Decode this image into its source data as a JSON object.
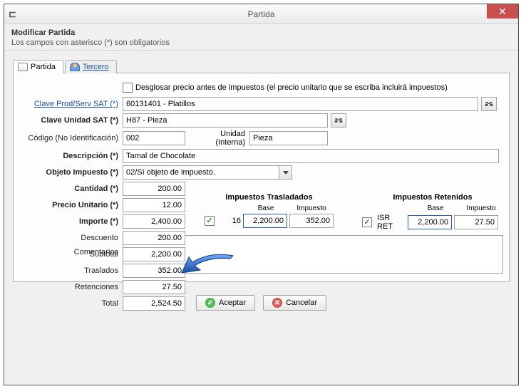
{
  "window": {
    "title": "Partida"
  },
  "header": {
    "title": "Modificar Partida",
    "subtitle": "Los campos con asterisco (*) son obligatorios"
  },
  "tabs": {
    "t0": "Partida",
    "t1": "Tercero"
  },
  "labels": {
    "desglosar": "Desglosar precio antes de impuestos (el precio unitario que se escriba incluirá impuestos)",
    "claveProdServ": "Clave Prod/Serv SAT (*)",
    "claveUnidad": "Clave Unidad SAT (*)",
    "codigo": "Código (No Identificación)",
    "unidadInterna": "Unidad (Interna)",
    "descripcion": "Descripción (*)",
    "objetoImpuesto": "Objeto Impuesto (*)",
    "cantidad": "Cantidad (*)",
    "precioUnitario": "Precio Unitario (*)",
    "importe": "Importe (*)",
    "descuento": "Descuento",
    "subtotal": "Subtotal",
    "traslados": "Traslados",
    "retenciones": "Retenciones",
    "total": "Total",
    "comentarios": "Comentarios",
    "impTrasladados": "Impuestos Trasladados",
    "impRetenidos": "Impuestos Retenidos",
    "base": "Base",
    "impuesto": "Impuesto"
  },
  "values": {
    "claveProdServ": "60131401 - Platillos",
    "claveUnidad": "H87 - Pieza",
    "codigo": "002",
    "unidadInterna": "Pieza",
    "descripcion": "Tamal de Chocolate",
    "objetoImpuesto": "02/Sí objeto de impuesto.",
    "cantidad": "200.00",
    "precioUnitario": "12.00",
    "importe": "2,400.00",
    "descuento": "200.00",
    "subtotal": "2,200.00",
    "traslados": "352.00",
    "retenciones": "27.50",
    "total": "2,524.50",
    "comentarios": ""
  },
  "tax": {
    "trasladado": {
      "label": "16",
      "base": "2,200.00",
      "impuesto": "352.00"
    },
    "retenido": {
      "label": "ISR RET",
      "base": "2,200.00",
      "impuesto": "27.50"
    }
  },
  "buttons": {
    "aceptar": "Aceptar",
    "cancelar": "Cancelar"
  }
}
